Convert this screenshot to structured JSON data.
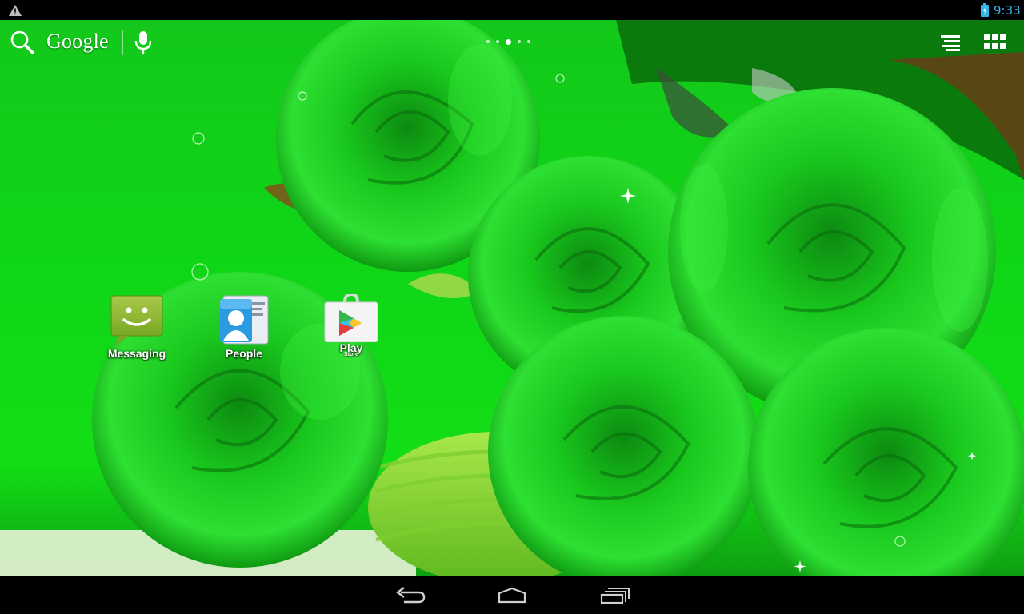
{
  "status_bar": {
    "time": "9:33",
    "icons": [
      "warning-icon",
      "battery-charging-icon"
    ]
  },
  "search": {
    "label": "Google",
    "icons": [
      "search-icon",
      "mic-icon"
    ]
  },
  "page_indicator": {
    "pages": 5,
    "active_index": 2
  },
  "top_actions": {
    "icons": [
      "widgets-icon",
      "all-apps-icon"
    ]
  },
  "apps": [
    {
      "label": "Messaging",
      "icon": "messaging-icon"
    },
    {
      "label": "People",
      "icon": "people-icon"
    },
    {
      "label": "Play",
      "sublabel": "Store",
      "icon": "play-store-icon"
    }
  ],
  "nav_bar": {
    "icons": [
      "back-icon",
      "home-icon",
      "recents-icon"
    ]
  },
  "colors": {
    "status_accent": "#33b5e5",
    "wallpaper_green": "#12d216"
  }
}
